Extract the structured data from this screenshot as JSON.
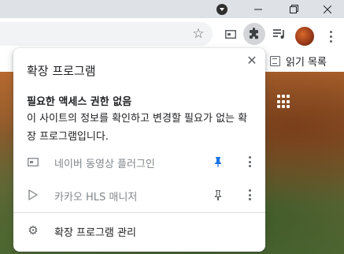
{
  "browser": {
    "bookmarks_bar": {
      "reading_list_label": "읽기 목록"
    }
  },
  "extensions_popup": {
    "title": "확장 프로그램",
    "section_heading": "필요한 액세스 권한 없음",
    "section_description": "이 사이트의 정보를 확인하고 변경할 필요가 없는 확장 프로그램입니다.",
    "extensions": [
      {
        "name": "네이버 동영상 플러그인",
        "icon": "media-player-icon",
        "pinned": true
      },
      {
        "name": "카카오 HLS 매니저",
        "icon": "play-triangle-icon",
        "pinned": false
      }
    ],
    "manage_label": "확장 프로그램 관리",
    "accent_color": "#1a73e8"
  }
}
